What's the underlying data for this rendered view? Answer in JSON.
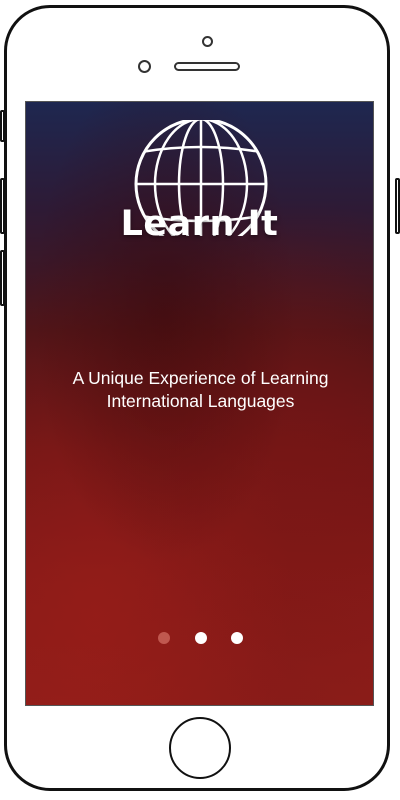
{
  "app": {
    "title": "Learn It",
    "tagline_line1": "A Unique Experience of Learning",
    "tagline_line2": "International Languages",
    "logo_icon": "globe-icon"
  },
  "pagination": {
    "total_pages": 3,
    "active_page": 1,
    "active_color": "#c0584f",
    "inactive_color": "#ffffff"
  },
  "theme": {
    "gradient_top": "#1e2750",
    "gradient_bottom": "#8d1d19"
  }
}
